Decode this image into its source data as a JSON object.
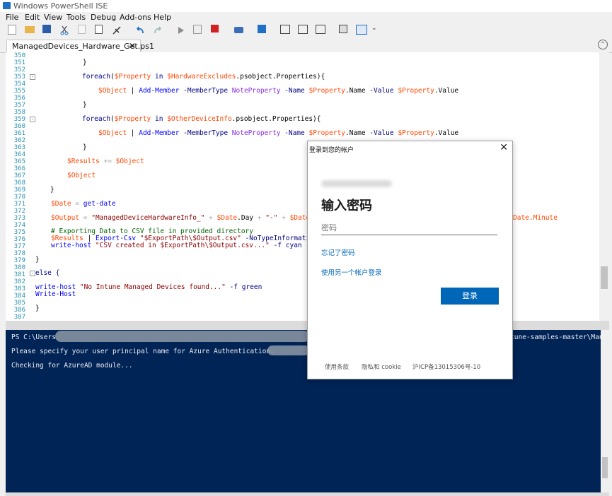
{
  "window": {
    "title": "Windows PowerShell ISE"
  },
  "menu": [
    "File",
    "Edit",
    "View",
    "Tools",
    "Debug",
    "Add-ons",
    "Help"
  ],
  "tab": {
    "label": "ManagedDevices_Hardware_Get.ps1",
    "close": "✕"
  },
  "editor": {
    "line_numbers": [
      "350",
      "351",
      "352",
      "353",
      "354",
      "355",
      "356",
      "357",
      "358",
      "359",
      "360",
      "361",
      "362",
      "363",
      "364",
      "365",
      "366",
      "367",
      "368",
      "369",
      "370",
      "371",
      "372",
      "373",
      "374",
      "375",
      "376",
      "377",
      "378",
      "379",
      "380",
      "381",
      "382",
      "383",
      "384",
      "385",
      "386",
      "387"
    ],
    "lines": {
      "l351": "}",
      "l353_kw": "foreach",
      "l353_a": "(",
      "l353_v": "$Property",
      "l353_in": " in ",
      "l353_v2": "$HardwareExcludes",
      "l353_b": ".psobject.Properties){",
      "l355_v": "$Object",
      "l355_pipe": " | ",
      "l355_cmd": "Add-Member",
      "l355_p1": " -MemberType ",
      "l355_t": "NoteProperty",
      "l355_p2": " -Name ",
      "l355_v2": "$Property",
      "l355_m": ".Name",
      "l355_p3": " -Value ",
      "l355_v3": "$Property",
      "l355_m2": ".Value",
      "l357": "}",
      "l359_kw": "foreach",
      "l359_a": "(",
      "l359_v": "$Property",
      "l359_in": " in ",
      "l359_v2": "$OtherDeviceInfo",
      "l359_b": ".psobject.Properties){",
      "l361_v": "$Object",
      "l361_pipe": " | ",
      "l361_cmd": "Add-Member",
      "l361_p1": " -MemberType ",
      "l361_t": "NoteProperty",
      "l361_p2": " -Name ",
      "l361_v2": "$Property",
      "l361_m": ".Name",
      "l361_p3": " -Value ",
      "l361_v3": "$Property",
      "l361_m2": ".Value",
      "l363": "}",
      "l365_v": "$Results",
      "l365_op": " += ",
      "l365_v2": "$Object",
      "l367_v": "$Object",
      "l369": "}",
      "l371_v": "$Date",
      "l371_op": " = ",
      "l371_cmd": "get-date",
      "l373_v": "$Output",
      "l373_op": " = ",
      "l373_s": "\"ManagedDeviceHardwareInfo_\"",
      "l373_plus": " + ",
      "l373_v2": "$Date",
      "l373_m": ".Day",
      "l373_plus2": " + ",
      "l373_s2": "\"-\"",
      "l373_plus3": " + ",
      "l373_v3": "$Date.M",
      "l373_tail": "Date.Minute",
      "l375": "# Exporting Data to CSV file in provided directory",
      "l376_v": "$Results",
      "l376_pipe": " | ",
      "l376_cmd": "Export-Csv",
      "l376_s": " \"$ExportPath\\$Output.csv\"",
      "l376_p": " -NoTypeInformation",
      "l377_cmd": "write-host",
      "l377_s": " \"CSV created in $ExportPath\\$Output.csv...\"",
      "l377_p": " -f ",
      "l377_c": "cyan",
      "l379": "}",
      "l381": "else {",
      "l383_cmd": "write-host",
      "l383_s": " \"No Intune Managed Devices found...\"",
      "l383_p": " -f ",
      "l383_c": "green",
      "l384_cmd": "Write-Host",
      "l386": "}"
    }
  },
  "console": {
    "line1_prefix": "PS C:\\Users",
    "line1_suffix": "tune-samples-master\\Man",
    "line2": "Please specify your user principal name for Azure Authentication:",
    "line3": "Checking for AzureAD module..."
  },
  "dialog": {
    "title": "登录到您的帐户",
    "close": "✕",
    "heading": "输入密码",
    "password_placeholder": "密码",
    "forgot": "忘记了密码",
    "other_account": "使用另一个帐户登录",
    "signin": "登录",
    "terms": "使用条款",
    "privacy": "隐私和 cookie",
    "icp": "沪ICP备13015306号-10"
  },
  "colors": {
    "console_bg": "#012456",
    "accent": "#0067b8"
  }
}
